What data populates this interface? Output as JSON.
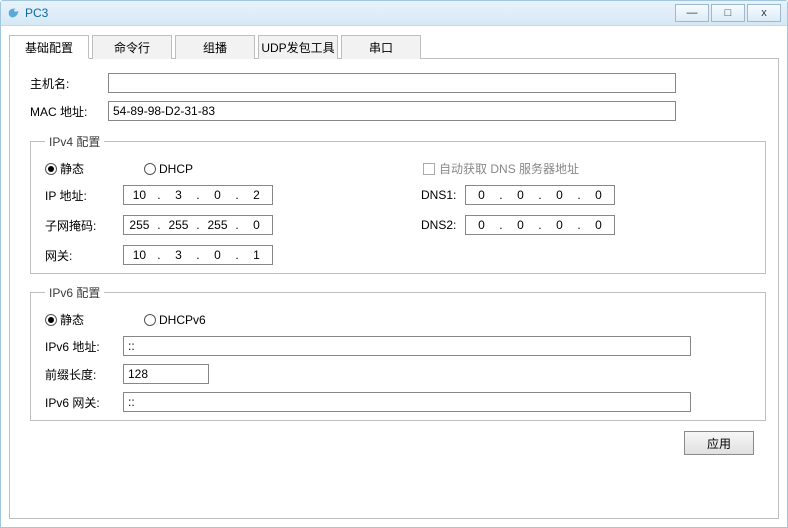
{
  "window": {
    "title": "PC3"
  },
  "tabs": [
    "基础配置",
    "命令行",
    "组播",
    "UDP发包工具",
    "串口"
  ],
  "form": {
    "hostname_label": "主机名:",
    "hostname_value": "",
    "mac_label": "MAC 地址:",
    "mac_value": "54-89-98-D2-31-83"
  },
  "ipv4": {
    "legend": "IPv4 配置",
    "static_label": "静态",
    "dhcp_label": "DHCP",
    "auto_dns_label": "自动获取 DNS 服务器地址",
    "ip_label": "IP 地址:",
    "ip": [
      "10",
      "3",
      "0",
      "2"
    ],
    "mask_label": "子网掩码:",
    "mask": [
      "255",
      "255",
      "255",
      "0"
    ],
    "gw_label": "网关:",
    "gw": [
      "10",
      "3",
      "0",
      "1"
    ],
    "dns1_label": "DNS1:",
    "dns1": [
      "0",
      "0",
      "0",
      "0"
    ],
    "dns2_label": "DNS2:",
    "dns2": [
      "0",
      "0",
      "0",
      "0"
    ]
  },
  "ipv6": {
    "legend": "IPv6 配置",
    "static_label": "静态",
    "dhcp_label": "DHCPv6",
    "addr_label": "IPv6 地址:",
    "addr_value": "::",
    "prefix_label": "前缀长度:",
    "prefix_value": "128",
    "gw_label": "IPv6 网关:",
    "gw_value": "::"
  },
  "apply_label": "应用",
  "win_btn": {
    "min": "—",
    "max": "□",
    "close": "x"
  }
}
